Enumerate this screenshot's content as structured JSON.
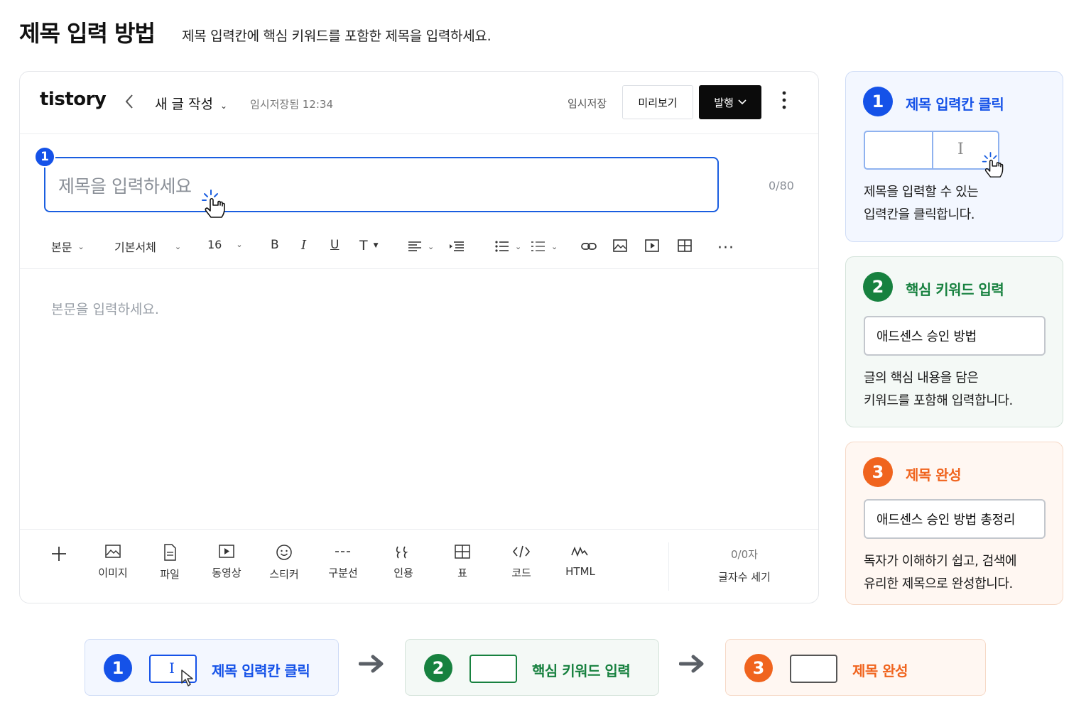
{
  "page": {
    "title": "제목 입력 방법",
    "subtitle": "제목 입력칸에 핵심 키워드를 포함한 제목을 입력하세요."
  },
  "editor": {
    "logo": "tistory",
    "back_icon": "chevron-left-icon",
    "mode_label": "새 글 작성",
    "autosave_status": "임시저장됨 12:34",
    "temp_save_label": "임시저장",
    "preview_label": "미리보기",
    "publish_label": "발행",
    "more_icon": "kebab-icon",
    "title_step_badge": "1",
    "title_placeholder": "제목을 입력하세요",
    "title_char_count": "0/80",
    "body_placeholder": "본문을 입력하세요.",
    "toolbar": {
      "paragraph_style": "본문",
      "font_family": "기본서체",
      "font_size": "16",
      "bold": "B",
      "italic": "I",
      "underline": "U",
      "text_style": "T"
    },
    "insert_bar": {
      "plus_icon": "plus-icon",
      "items": [
        {
          "label": "이미지",
          "icon": "image-icon"
        },
        {
          "label": "파일",
          "icon": "file-icon"
        },
        {
          "label": "동영상",
          "icon": "video-icon"
        },
        {
          "label": "스티커",
          "icon": "smile-icon"
        },
        {
          "label": "구분선",
          "icon": "divider-icon"
        },
        {
          "label": "인용",
          "icon": "quote-icon"
        },
        {
          "label": "표",
          "icon": "table-icon"
        },
        {
          "label": "코드",
          "icon": "code-icon"
        },
        {
          "label": "HTML",
          "icon": "html-icon"
        }
      ],
      "word_count_value": "0/0자",
      "word_count_label": "글자수 세기"
    }
  },
  "steps": [
    {
      "number": "1",
      "title": "제목 입력칸 클릭",
      "description_line1": "제목을 입력할 수 있는",
      "description_line2": "입력칸을 클릭합니다.",
      "color": "#1552e8"
    },
    {
      "number": "2",
      "title": "핵심 키워드 입력",
      "sample": "애드센스 승인 방법",
      "description_line1": "글의 핵심 내용을 담은",
      "description_line2": "키워드를 포함해 입력합니다.",
      "color": "#17813f"
    },
    {
      "number": "3",
      "title": "제목 완성",
      "sample": "애드센스 승인 방법 총정리",
      "description_line1": "독자가 이해하기 쉽고, 검색에",
      "description_line2": "유리한 제목으로 완성합니다.",
      "color": "#f0641e"
    }
  ],
  "flow": {
    "items": [
      {
        "number": "1",
        "label": "제목 입력칸 클릭"
      },
      {
        "number": "2",
        "label": "핵심 키워드 입력"
      },
      {
        "number": "3",
        "label": "제목 완성"
      }
    ],
    "arrow_icon": "arrow-right-icon"
  }
}
